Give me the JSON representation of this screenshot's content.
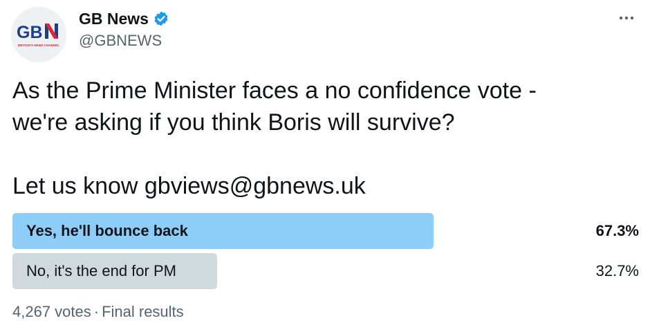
{
  "author": {
    "display_name": "GB News",
    "handle": "@GBNEWS",
    "verified_icon": "verified-badge-icon",
    "avatar": {
      "logo_text": "GBN",
      "tagline": "BRITAIN'S NEWS CHANNEL"
    }
  },
  "menu": {
    "icon": "more-icon"
  },
  "tweet": {
    "line1": "As the Prime Minister faces a no confidence vote -",
    "line2": "we're asking if you think Boris will survive?",
    "line3": "Let us know gbviews@gbnews.uk"
  },
  "poll": {
    "options": [
      {
        "label": "Yes, he'll bounce back",
        "percent_text": "67.3%",
        "percent": 67.3,
        "winner": true
      },
      {
        "label": "No, it's the end for PM",
        "percent_text": "32.7%",
        "percent": 32.7,
        "winner": false
      }
    ],
    "votes": "4,267 votes",
    "separator": "·",
    "status": "Final results"
  },
  "colors": {
    "winner_bar": "#8ecdf7",
    "loser_bar": "#cfd9de",
    "verified": "#1d9bf0",
    "logo_red": "#d7263d",
    "logo_blue": "#1b3f8c"
  }
}
